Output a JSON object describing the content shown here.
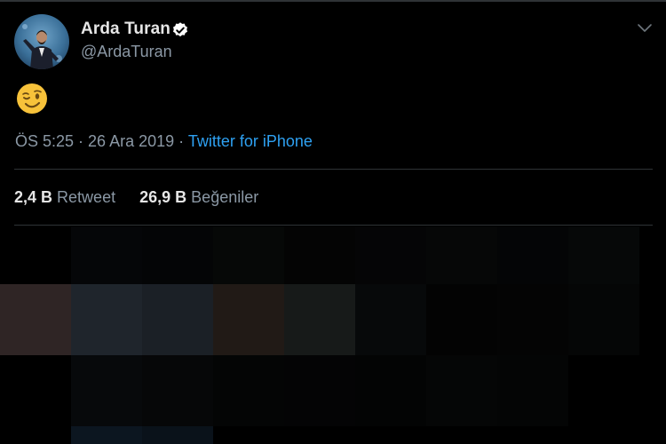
{
  "tweet": {
    "author_name": "Arda Turan",
    "author_handle": "@ArdaTuran",
    "verified": true,
    "content_emoji": "winking-face",
    "time": "ÖS 5:25",
    "separator": " · ",
    "date": "26 Ara 2019",
    "source": "Twitter for iPhone",
    "retweet_count": "2,4 B",
    "retweet_label": "Retweet",
    "like_count": "26,9 B",
    "like_label": "Beğeniler"
  },
  "icons": {
    "verified": "verified-badge-icon",
    "menu": "chevron-down-icon"
  },
  "colors": {
    "background": "#000000",
    "link": "#2ea1f2",
    "secondary_text": "#8b98a5",
    "verified_badge": "#ffffff"
  }
}
